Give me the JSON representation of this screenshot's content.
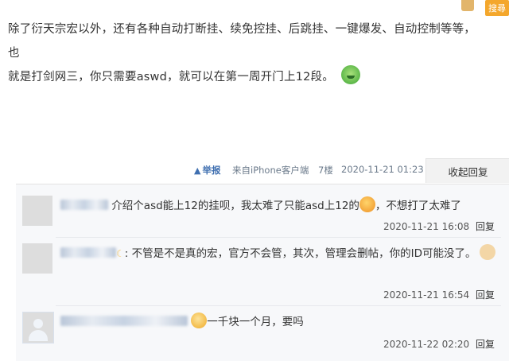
{
  "post": {
    "line1": "除了衍天宗宏以外，还有各种自动打断挂、续免控挂、后跳挂、一键爆发、自动控制等等，也",
    "line2": "就是打剑网三，你只需要aswd，就可以在第一周开门上12段。"
  },
  "top_right": {
    "report_button": "搜尋"
  },
  "meta": {
    "report_label": "举报",
    "report_icon": "▲",
    "source": "来自iPhone客户端",
    "floor": "7楼",
    "time": "2020-11-21 01:23",
    "collapse_label": "收起回复"
  },
  "replies": [
    {
      "text_before": "介绍个asd能上12的挂呗，我太难了只能asd上12的",
      "text_after": "，不想打了太难了",
      "time": "2020-11-21 16:08",
      "reply_label": "回复"
    },
    {
      "text": ": 不管是不是真的宏，官方不会管，其次，管理会删帖，你的ID可能没了。",
      "time": "2020-11-21 16:54",
      "reply_label": "回复"
    },
    {
      "text": "一千块一个月，要吗",
      "time": "2020-11-22 02:20",
      "reply_label": "回复"
    }
  ]
}
